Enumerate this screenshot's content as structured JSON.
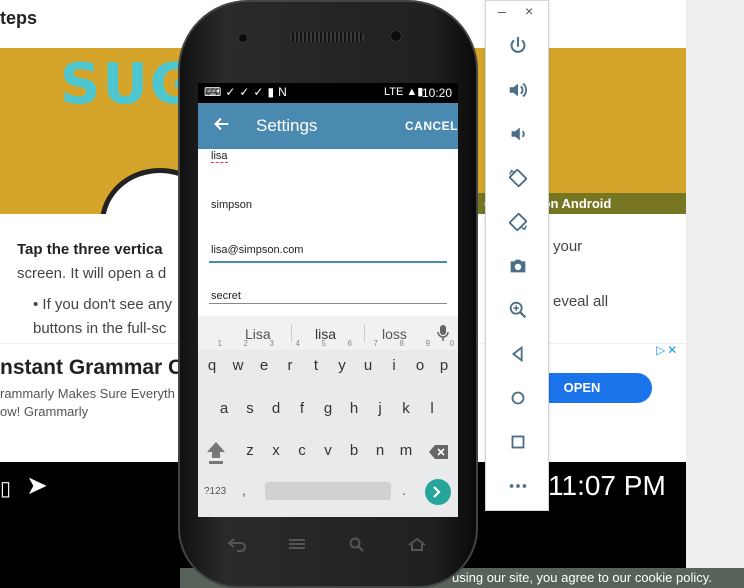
{
  "background": {
    "heading": "teps",
    "banner_art": "SUG",
    "banner_caption": "e Photos on Android",
    "step_text_bold": "Tap the three vertica",
    "step_text_rest": "screen. It will open a d",
    "step_text_right": "your",
    "bullet_text": "If you don't see any",
    "bullet_text_2": "buttons in the full-sc",
    "bullet_right": "eveal all",
    "ad": {
      "title": "nstant Grammar C",
      "line1": "rammarly Makes Sure Everyth",
      "line2": "ow! Grammarly",
      "open_label": "OPEN",
      "choices": "▷✕"
    },
    "video_time": "11:07 PM",
    "cookie_text": "using our site, you agree to our cookie policy."
  },
  "emulator_toolbar": {
    "minimize": "–",
    "close": "×",
    "buttons": [
      "power",
      "volume-up",
      "volume-down",
      "rotate-left",
      "rotate-right",
      "screenshot",
      "zoom",
      "back",
      "home",
      "overview",
      "more"
    ]
  },
  "phone": {
    "status": {
      "left_icons": "⌨✓✓✓▮N",
      "right_icons": "LTE ▲▮",
      "time": "10:20"
    },
    "app_bar": {
      "title": "Settings",
      "cancel_label": "CANCEL"
    },
    "fields": {
      "first_name": "lisa",
      "last_name": "simpson",
      "email": "lisa@simpson.com",
      "password": "secret"
    },
    "keyboard": {
      "suggestions": [
        "Lisa",
        "lisa",
        "loss"
      ],
      "row1": [
        "q",
        "w",
        "e",
        "r",
        "t",
        "y",
        "u",
        "i",
        "o",
        "p"
      ],
      "row1_hints": [
        "1",
        "2",
        "3",
        "4",
        "5",
        "6",
        "7",
        "8",
        "9",
        "0"
      ],
      "row2": [
        "a",
        "s",
        "d",
        "f",
        "g",
        "h",
        "j",
        "k",
        "l"
      ],
      "row3": [
        "z",
        "x",
        "c",
        "v",
        "b",
        "n",
        "m"
      ],
      "symbols_label": "?123",
      "comma": ",",
      "period": "."
    }
  }
}
